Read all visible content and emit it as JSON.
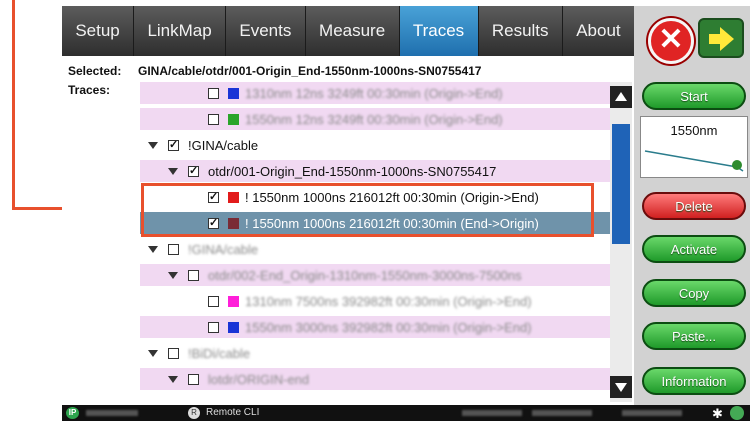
{
  "tabs": [
    {
      "label": "Setup",
      "active": false
    },
    {
      "label": "LinkMap",
      "active": false
    },
    {
      "label": "Events",
      "active": false
    },
    {
      "label": "Measure",
      "active": false
    },
    {
      "label": "Traces",
      "active": true
    },
    {
      "label": "Results",
      "active": false
    },
    {
      "label": "About",
      "active": false
    }
  ],
  "info": {
    "selected_label": "Selected:",
    "selected_value": "GINA/cable/otdr/001-Origin_End-1550nm-1000ns-SN0755417",
    "traces_label": "Traces:"
  },
  "tree": [
    {
      "indent": 2,
      "kind": "trace",
      "color": "#1a35d6",
      "label": "1310nm 12ns 3249ft 00:30min (Origin->End)",
      "style": "pink",
      "blur": true
    },
    {
      "indent": 2,
      "kind": "trace",
      "color": "#2aa52a",
      "label": "1550nm 12ns 3249ft 00:30min (Origin->End)",
      "style": "pink",
      "blur": true
    },
    {
      "indent": 0,
      "kind": "folder",
      "checked": true,
      "label": "!GINA/cable",
      "style": "white",
      "blur": false
    },
    {
      "indent": 1,
      "kind": "folder",
      "checked": true,
      "label": "otdr/001-Origin_End-1550nm-1000ns-SN0755417",
      "style": "pink",
      "blur": false
    },
    {
      "indent": 2,
      "kind": "trace",
      "checked": true,
      "color": "#e21b1b",
      "label": "! 1550nm 1000ns 216012ft 00:30min (Origin->End)",
      "style": "white",
      "blur": false
    },
    {
      "indent": 2,
      "kind": "trace",
      "checked": true,
      "color": "#7a2b36",
      "label": "! 1550nm 1000ns 216012ft 00:30min (End->Origin)",
      "style": "sel",
      "blur": false
    },
    {
      "indent": 0,
      "kind": "folder",
      "label": "!GINA/cable",
      "style": "white",
      "blur": true
    },
    {
      "indent": 1,
      "kind": "folder",
      "label": "otdr/002-End_Origin-1310nm-1550nm-3000ns-7500ns",
      "style": "pink",
      "blur": true
    },
    {
      "indent": 2,
      "kind": "trace",
      "color": "#ff1fd9",
      "label": "1310nm 7500ns 392982ft 00:30min (Origin->End)",
      "style": "white",
      "blur": true
    },
    {
      "indent": 2,
      "kind": "trace",
      "color": "#1a35d6",
      "label": "1550nm 3000ns 392982ft 00:30min (Origin->End)",
      "style": "pink",
      "blur": true
    },
    {
      "indent": 0,
      "kind": "folder",
      "label": "!BiDi/cable",
      "style": "white",
      "blur": true
    },
    {
      "indent": 1,
      "kind": "folder",
      "label": "lotdr/ORIGIN-end",
      "style": "pink",
      "blur": true
    }
  ],
  "right_panel": {
    "close_icon": "close-icon",
    "next_icon": "arrow-right-icon",
    "start_label": "Start",
    "preview_label": "1550nm",
    "delete_label": "Delete",
    "activate_label": "Activate",
    "copy_label": "Copy",
    "paste_label": "Paste...",
    "information_label": "Information"
  },
  "status": {
    "ip_badge": "IP",
    "remote_label": "Remote CLI"
  },
  "colors": {
    "accent_tab": "#1f6fae",
    "highlight": "#e8502d",
    "selected_row": "#6f93aa",
    "pink_row": "#f1d9f2"
  }
}
